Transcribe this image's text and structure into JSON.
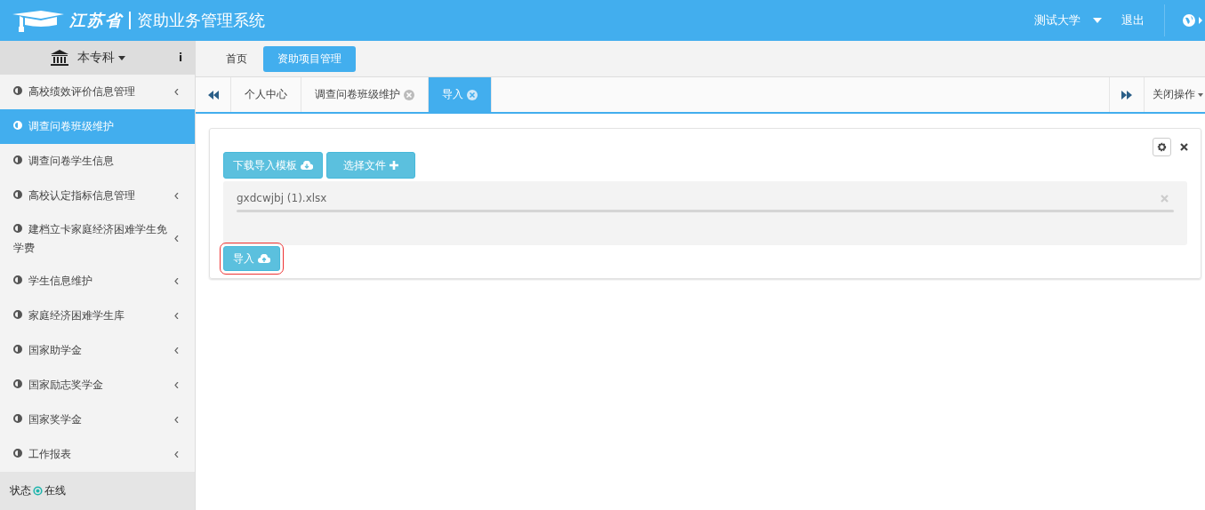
{
  "header": {
    "logo_text": "江苏省",
    "title": "资助业务管理系统",
    "user": "测试大学",
    "logout": "退出"
  },
  "sidebar": {
    "level_label": "本专科",
    "info": "i",
    "items": [
      {
        "label": "高校绩效评价信息管理",
        "selected": false,
        "expandable": true
      },
      {
        "label": "调查问卷班级维护",
        "selected": true,
        "expandable": false
      },
      {
        "label": "调查问卷学生信息",
        "selected": false,
        "expandable": false
      },
      {
        "label": "高校认定指标信息管理",
        "selected": false,
        "expandable": true
      },
      {
        "label": "建档立卡家庭经济困难学生免学费",
        "selected": false,
        "expandable": true
      },
      {
        "label": "学生信息维护",
        "selected": false,
        "expandable": true
      },
      {
        "label": "家庭经济困难学生库",
        "selected": false,
        "expandable": true
      },
      {
        "label": "国家助学金",
        "selected": false,
        "expandable": true
      },
      {
        "label": "国家励志奖学金",
        "selected": false,
        "expandable": true
      },
      {
        "label": "国家奖学金",
        "selected": false,
        "expandable": true
      },
      {
        "label": "工作报表",
        "selected": false,
        "expandable": true
      }
    ],
    "status_label": "状态",
    "status_value": "在线"
  },
  "top_nav": [
    {
      "label": "首页",
      "selected": false
    },
    {
      "label": "资助项目管理",
      "selected": true
    }
  ],
  "page_tabs": [
    {
      "label": "个人中心",
      "selected": false,
      "closable": false
    },
    {
      "label": "调查问卷班级维护",
      "selected": false,
      "closable": true
    },
    {
      "label": "导入",
      "selected": true,
      "closable": true
    }
  ],
  "close_menu": "关闭操作",
  "upload": {
    "download_button": "下载导入模板",
    "choose_button": "选择文件",
    "files": [
      {
        "name": "gxdcwjbj (1).xlsx"
      }
    ],
    "import_button": "导入"
  }
}
